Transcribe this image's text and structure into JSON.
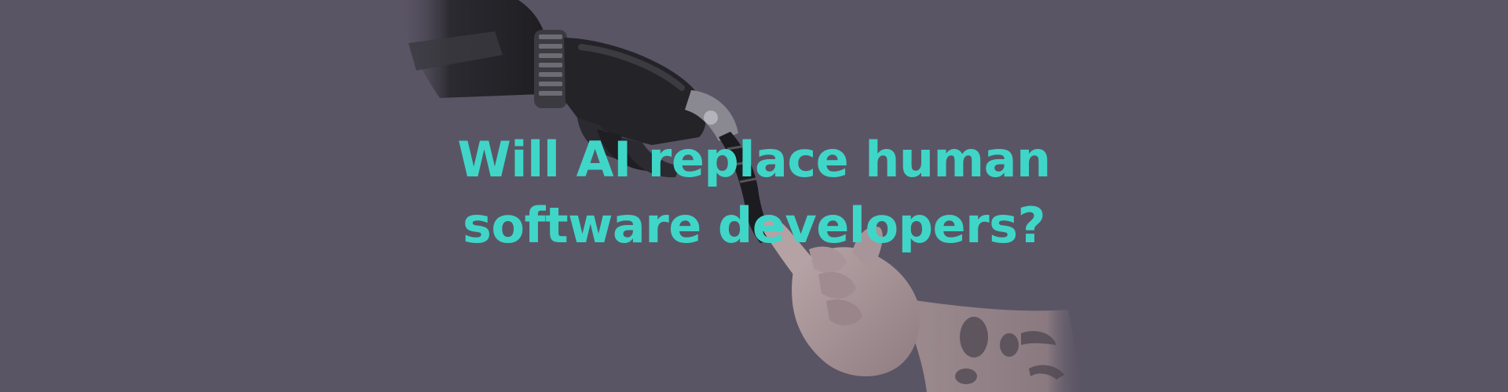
{
  "hero": {
    "title_line_1": "Will AI replace human",
    "title_line_2": "software developers?",
    "image": "robot-hand-and-human-hand-nearly-touching"
  },
  "colors": {
    "background": "#5a5565",
    "title": "#3fd6c8"
  }
}
